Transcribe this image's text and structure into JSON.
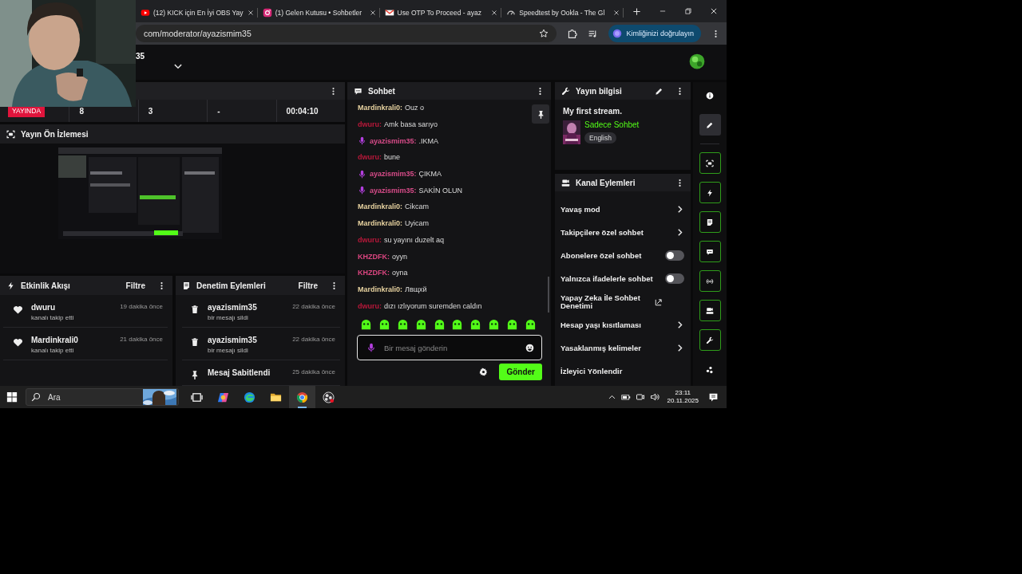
{
  "browser": {
    "tabs": [
      {
        "title": "(12) KICK için En İyi OBS Yay",
        "selected": false
      },
      {
        "title": "(1) Gelen Kutusu • Sohbetler",
        "selected": false
      },
      {
        "title": "Use OTP To Proceed - ayaz",
        "selected": false
      },
      {
        "title": "Speedtest by Ookla - The Gl",
        "selected": false
      }
    ],
    "url": "com/moderator/ayazismim35",
    "profile_button": "Kimliğinizi doğrulayın"
  },
  "header": {
    "channel": "35"
  },
  "stream_stats": {
    "live_badge": "YAYINDA",
    "values": [
      "8",
      "3",
      "-",
      "00:04:10"
    ]
  },
  "preview": {
    "title": "Yayın Ön İzlemesi"
  },
  "activity": {
    "title": "Etkinlik Akışı",
    "filter": "Filtre",
    "events": [
      {
        "user": "dwuru",
        "action": "kanalı takip etti",
        "time": "19 dakika önce"
      },
      {
        "user": "Mardinkrali0",
        "action": "kanalı takip etti",
        "time": "21 dakika önce"
      }
    ]
  },
  "moderation": {
    "title": "Denetim Eylemleri",
    "filter": "Filtre",
    "items": [
      {
        "kind": "delete",
        "user": "ayazismim35",
        "action": "bir mesajı sildi",
        "time": "22 dakika önce"
      },
      {
        "kind": "delete",
        "user": "ayazismim35",
        "action": "bir mesajı sildi",
        "time": "22 dakika önce"
      },
      {
        "kind": "pin",
        "user": "Mesaj Sabitlendi",
        "time": "25 dakika önce"
      }
    ]
  },
  "chat": {
    "title": "Sohbet",
    "messages": [
      {
        "user": "Mardinkrali0:",
        "color": "#e8d3a0",
        "badge": false,
        "text": "Ouz o"
      },
      {
        "user": "dwuru:",
        "color": "#b8183a",
        "badge": false,
        "text": "Amk basa sarıyo"
      },
      {
        "user": "ayazismim35:",
        "color": "#d94c8a",
        "badge": true,
        "text": ".IKMA"
      },
      {
        "user": "dwuru:",
        "color": "#b8183a",
        "badge": false,
        "text": "bune"
      },
      {
        "user": "ayazismim35:",
        "color": "#d94c8a",
        "badge": true,
        "text": "ÇIKMA"
      },
      {
        "user": "ayazismim35:",
        "color": "#d94c8a",
        "badge": true,
        "text": "SAKİN OLUN"
      },
      {
        "user": "Mardinkrali0:",
        "color": "#e8d3a0",
        "badge": false,
        "text": "Cikcam"
      },
      {
        "user": "Mardinkrali0:",
        "color": "#e8d3a0",
        "badge": false,
        "text": "Uyicam"
      },
      {
        "user": "dwuru:",
        "color": "#b8183a",
        "badge": false,
        "text": "su yayını duzelt aq"
      },
      {
        "user": "KHZDFK:",
        "color": "#d9457f",
        "badge": false,
        "text": "oyyn"
      },
      {
        "user": "KHZDFK:",
        "color": "#d9457f",
        "badge": false,
        "text": "oyna"
      },
      {
        "user": "Mardinkrali0:",
        "color": "#e8d3a0",
        "badge": false,
        "text": "Лвщхй"
      },
      {
        "user": "dwuru:",
        "color": "#b8183a",
        "badge": false,
        "text": "dızı ızlıyorum suremden caldın"
      }
    ],
    "placeholder": "Bir mesaj gönderin",
    "send": "Gönder"
  },
  "stream_info": {
    "title": "Yayın bilgisi",
    "stream_title": "My first stream.",
    "category": "Sadece Sohbet",
    "tags": [
      "English"
    ]
  },
  "channel_actions": {
    "title": "Kanal Eylemleri",
    "items": [
      {
        "kind": "chevron",
        "label": "Yavaş mod"
      },
      {
        "kind": "chevron",
        "label": "Takipçilere özel sohbet"
      },
      {
        "kind": "toggle",
        "label": "Abonelere özel sohbet",
        "on": false
      },
      {
        "kind": "toggle",
        "label": "Yalnızca ifadelerle sohbet",
        "on": false
      },
      {
        "kind": "external",
        "label": "Yapay Zeka İle Sohbet Denetimi"
      },
      {
        "kind": "chevron",
        "label": "Hesap yaşı kısıtlaması"
      },
      {
        "kind": "chevron",
        "label": "Yasaklanmış kelimeler"
      },
      {
        "kind": "plain",
        "label": "İzleyici Yönlendir"
      }
    ]
  },
  "tool_rail": [
    {
      "selected": false,
      "added": false
    },
    {
      "selected": true,
      "added": false
    },
    {
      "selected": false,
      "added": true
    },
    {
      "selected": false,
      "added": true
    },
    {
      "selected": false,
      "added": true
    },
    {
      "selected": false,
      "added": true
    },
    {
      "selected": false,
      "added": true
    },
    {
      "selected": false,
      "added": true
    },
    {
      "selected": false,
      "added": true
    },
    {
      "selected": false,
      "added": false
    }
  ],
  "taskbar": {
    "search": {
      "placeholder": "Ara"
    },
    "apps": [
      {
        "selected": false
      },
      {
        "selected": false
      },
      {
        "selected": false
      },
      {
        "selected": false
      },
      {
        "selected": true
      },
      {
        "selected": false
      }
    ],
    "time": "23:11",
    "date": "20.11.2025"
  }
}
